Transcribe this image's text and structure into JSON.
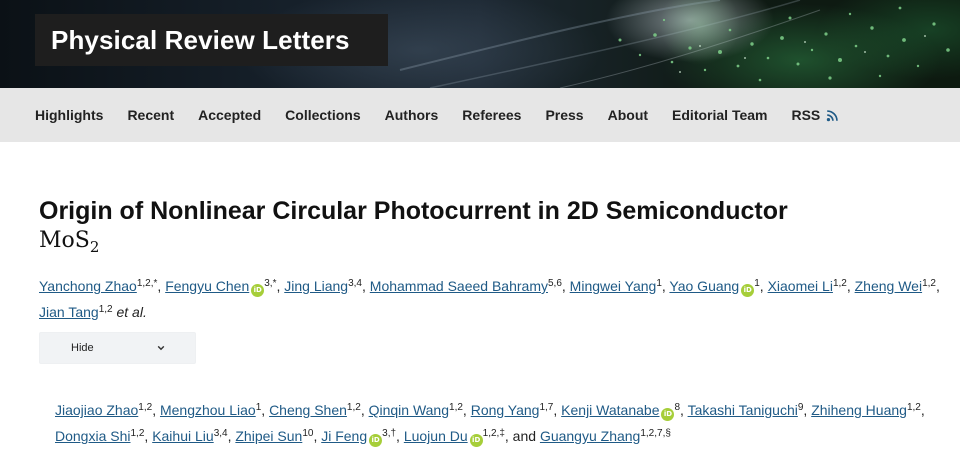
{
  "journal": {
    "title": "Physical Review Letters"
  },
  "nav": {
    "items": [
      "Highlights",
      "Recent",
      "Accepted",
      "Collections",
      "Authors",
      "Referees",
      "Press",
      "About",
      "Editorial Team",
      "RSS"
    ]
  },
  "article": {
    "title": "Origin of Nonlinear Circular Photocurrent in 2D Semiconductor",
    "title_formula_base": "MoS",
    "title_formula_sub": "2",
    "etal": "et al.",
    "hide_label": "Hide",
    "conjunction": ", and ",
    "authors": [
      {
        "name": "Yanchong Zhao",
        "sup": "1,2,*"
      },
      {
        "name": "Fengyu Chen",
        "sup": "3,*",
        "orcid": true
      },
      {
        "name": "Jing Liang",
        "sup": "3,4"
      },
      {
        "name": "Mohammad Saeed Bahramy",
        "sup": "5,6"
      },
      {
        "name": "Mingwei Yang",
        "sup": "1"
      },
      {
        "name": "Yao Guang",
        "sup": "1",
        "orcid": true
      },
      {
        "name": "Xiaomei Li",
        "sup": "1,2"
      },
      {
        "name": "Zheng Wei",
        "sup": "1,2"
      },
      {
        "name": "Jian Tang",
        "sup": "1,2"
      }
    ],
    "more_authors": [
      {
        "name": "Jiaojiao Zhao",
        "sup": "1,2"
      },
      {
        "name": "Mengzhou Liao",
        "sup": "1"
      },
      {
        "name": "Cheng Shen",
        "sup": "1,2"
      },
      {
        "name": "Qinqin Wang",
        "sup": "1,2"
      },
      {
        "name": "Rong Yang",
        "sup": "1,7"
      },
      {
        "name": "Kenji Watanabe",
        "sup": "8",
        "orcid": true
      },
      {
        "name": "Takashi Taniguchi",
        "sup": "9"
      },
      {
        "name": "Zhiheng Huang",
        "sup": "1,2"
      },
      {
        "name": "Dongxia Shi",
        "sup": "1,2"
      },
      {
        "name": "Kaihui Liu",
        "sup": "3,4"
      },
      {
        "name": "Zhipei Sun",
        "sup": "10"
      },
      {
        "name": "Ji Feng",
        "sup": "3,†",
        "orcid": true
      },
      {
        "name": "Luojun Du",
        "sup": "1,2,‡",
        "orcid": true
      },
      {
        "name": "Guangyu Zhang",
        "sup": "1,2,7,§"
      }
    ]
  },
  "colors": {
    "link": "#1f5a86",
    "orcid": "#a6ce39",
    "nav_bg": "#e6e6e6",
    "brand_box": "#1e1e1e"
  },
  "icons": {
    "rss": "rss-icon",
    "orcid": "orcid-icon",
    "chevron": "chevron-down-icon"
  }
}
